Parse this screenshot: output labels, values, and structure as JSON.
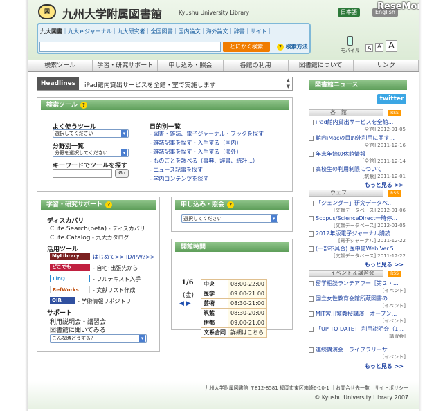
{
  "header": {
    "logo_text": "図",
    "title": "九州大学附属図書館",
    "subtitle": "Kyushu University Library",
    "lang_ja": "日本語",
    "lang_en": "English",
    "watermark": "ReseMom"
  },
  "search": {
    "tabs": [
      "九大図書",
      "九大ｅジャーナル",
      "九大研究者",
      "全国図書",
      "国内論文",
      "海外論文",
      "辞書",
      "サイト"
    ],
    "placeholder": "",
    "button": "とにかく検索",
    "help": "検索方法"
  },
  "mobile": "モバイル",
  "fontsizes": [
    "A",
    "A",
    "A"
  ],
  "nav": [
    "検索ツール",
    "学習・研究サポート",
    "申し込み・照会",
    "各館の利用",
    "図書館について",
    "リンク"
  ],
  "headlines": {
    "label": "Headlines",
    "text": "iPad館内貸出サービスを全館・室で実施します"
  },
  "searchtools": {
    "title": "検索ツール",
    "often": "よく使うツール",
    "often_sel": "選択してください",
    "field": "分野別一覧",
    "field_sel": "分野を選択してください",
    "keyword": "キーワードでツールを探す",
    "go": "Go",
    "purpose": "目的別一覧",
    "links": [
      "- 図書・雑誌、電子ジャーナル・ブックを探す",
      "- 雑誌記事を探す・入手する（国内）",
      "- 雑誌記事を探す・入手する（海外）",
      "- ものごとを調べる（事典、辞書、統計...）",
      "- ニュース記事を探す",
      "- 学内コンテンツを探す"
    ]
  },
  "support": {
    "title": "学習・研究サポート",
    "discovery": "ディスカバリ",
    "cute_search": "Cute.Search(beta)",
    "cute_search_desc": " - ディスカバリ",
    "cute_catalog": "Cute.Catalog",
    "cute_catalog_desc": " - 九大カタログ",
    "tools": "活用ツール",
    "mylibrary": "MyLibrary",
    "mylib_desc": "はじめて>> ID/PW?>>",
    "dokodemo": "どこでも",
    "dokodemo_desc": "- 自宅･出張先から",
    "linq": "LinQ",
    "linq_desc": "- フルテキスト入手",
    "refworks": "RefWorks",
    "refworks_desc": "- 文献リスト作成",
    "qir": "QIR",
    "qir_desc": "- 学術情報リポジトリ",
    "support": "サポート",
    "manual": "利用説明会・講習会",
    "ask": "図書館に聞いてみる",
    "help_sel": "こんな時どうする？"
  },
  "apply": {
    "title": "申し込み・照会",
    "sel": "選択してください"
  },
  "hours": {
    "title": "開館時間",
    "date": "1/6",
    "day": "(金)",
    "rows": [
      [
        "中央",
        "08:00-22:00"
      ],
      [
        "医学",
        "09:00-21:00"
      ],
      [
        "芸術",
        "08:30-21:00"
      ],
      [
        "筑紫",
        "08:30-20:00"
      ],
      [
        "伊都",
        "09:00-21:00"
      ],
      [
        "文系合同",
        "詳細はこちら"
      ]
    ]
  },
  "news": {
    "title": "図書館ニュース",
    "twitter": "twitter",
    "rss": "RSS",
    "more": "もっと見る >>",
    "cats": [
      {
        "name": "各　館",
        "items": [
          {
            "t": "iPad館内貸出サービスを全館...",
            "m": "[全館] 2012-01-05"
          },
          {
            "t": "館内iMacの目的外利用に関す...",
            "m": "[全館] 2011-12-16"
          },
          {
            "t": "年末年始の休館情報",
            "m": "[全館] 2011-12-14"
          },
          {
            "t": "高校生の利用制限について",
            "m": "[筑紫] 2011-12-01"
          }
        ]
      },
      {
        "name": "ウェブ",
        "items": [
          {
            "t": "「ジェンダー」研究データベ...",
            "m": "[文献データベース] 2012-01-06"
          },
          {
            "t": "Scopus/ScienceDirect一時停...",
            "m": "[文献データベース] 2012-01-05"
          },
          {
            "t": "2012年版電子ジャーナル購読...",
            "m": "[電子ジャーナル] 2011-12-22"
          },
          {
            "t": "(一部不具合) 医中誌Web Ver.5",
            "m": "[文献データベース] 2011-12-22"
          }
        ]
      },
      {
        "name": "イベント＆講習会",
        "items": [
          {
            "t": "留学相談ランチアワー［第２・...",
            "m": "[イベント]"
          },
          {
            "t": "国立女性教育会館所蔵図書の...",
            "m": "[イベント]"
          },
          {
            "t": "MIT宮川繁教授講演「オープン...",
            "m": "[イベント]"
          },
          {
            "t": "「UP TO DATE」 利用説明会（1...",
            "m": "[講習会]"
          },
          {
            "t": "連続講演会「ライブラリーサ...",
            "m": "[イベント]"
          }
        ]
      }
    ]
  },
  "footer": {
    "addr": "九州大学附属図書館 〒812-8581 福岡市東区箱崎6-10-1 ｜お問合せ先一覧｜サイトポリシー",
    "copy": "© Kyushu University Library 2007"
  }
}
